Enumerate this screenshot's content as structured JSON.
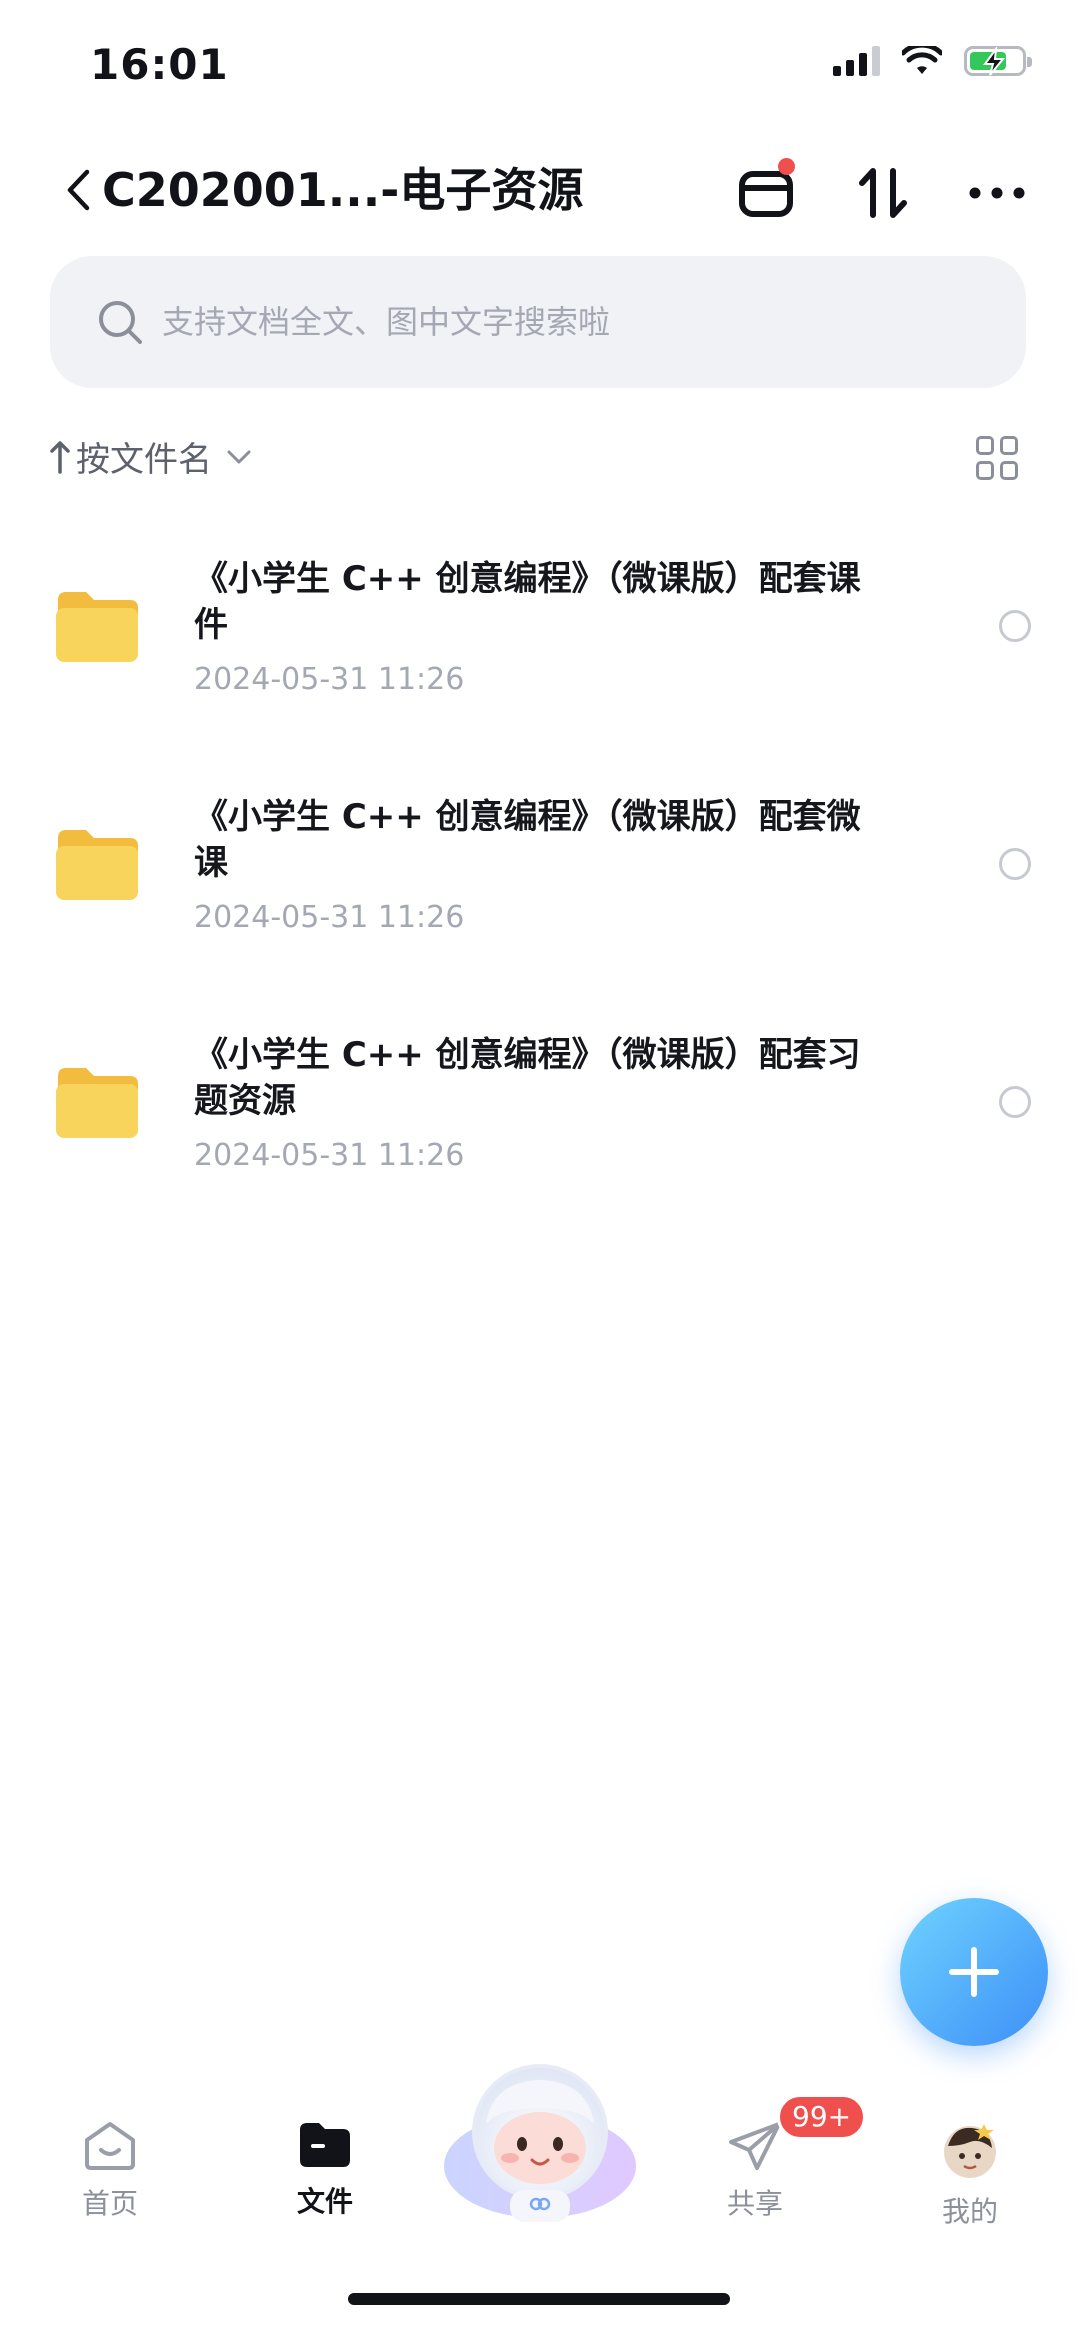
{
  "status_bar": {
    "time": "16:01"
  },
  "header": {
    "title": "C202001...-电子资源"
  },
  "search": {
    "placeholder": "支持文档全文、图中文字搜索啦"
  },
  "sort": {
    "label": "按文件名"
  },
  "files": [
    {
      "name": "《小学生 C++ 创意编程》（微课版）配套课件",
      "date": "2024-05-31 11:26"
    },
    {
      "name": "《小学生 C++ 创意编程》（微课版）配套微课",
      "date": "2024-05-31 11:26"
    },
    {
      "name": "《小学生 C++ 创意编程》（微课版）配套习题资源",
      "date": "2024-05-31 11:26"
    }
  ],
  "nav": {
    "home": "首页",
    "files": "文件",
    "share": "共享",
    "share_badge": "99+",
    "me": "我的"
  },
  "colors": {
    "accent": "#3d8ff7",
    "folder": "#f9d45c",
    "badge": "#f0504d",
    "battery": "#34c759"
  }
}
